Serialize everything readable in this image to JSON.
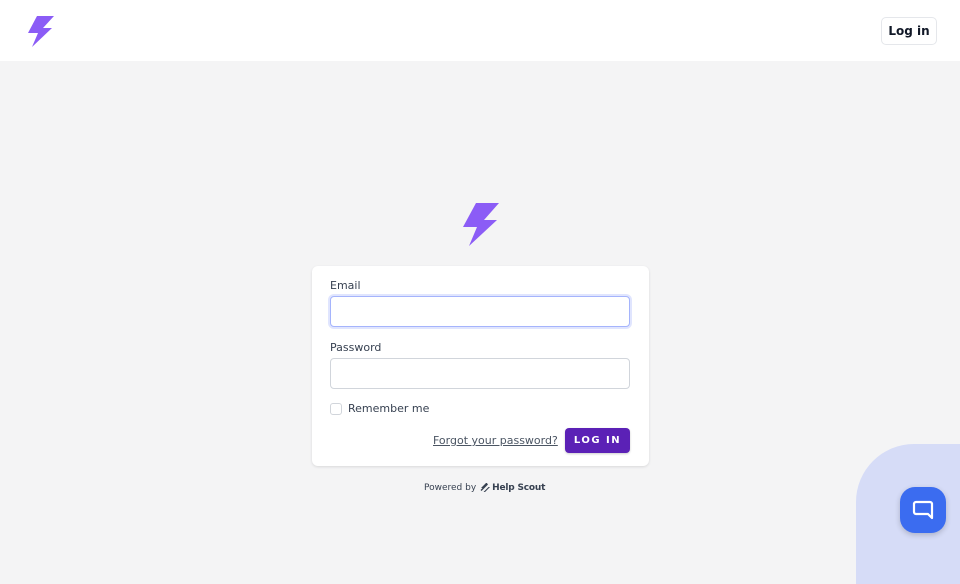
{
  "header": {
    "login_label": "Log in"
  },
  "form": {
    "email_label": "Email",
    "email_value": "",
    "password_label": "Password",
    "password_value": "",
    "remember_label": "Remember me",
    "remember_checked": false,
    "forgot_label": "Forgot your password?",
    "submit_label": "LOG IN"
  },
  "footer": {
    "powered_text": "Powered by",
    "brand": "Help Scout"
  },
  "icons": {
    "logo": "lightning-bolt-icon",
    "beacon": "chat-bubble-icon",
    "helpscout": "helpscout-logo-icon"
  },
  "colors": {
    "brand_purple": "#8b5cf6",
    "button_purple": "#5b21b6",
    "beacon_blue": "#3b6cf0",
    "background": "#f4f4f5"
  }
}
